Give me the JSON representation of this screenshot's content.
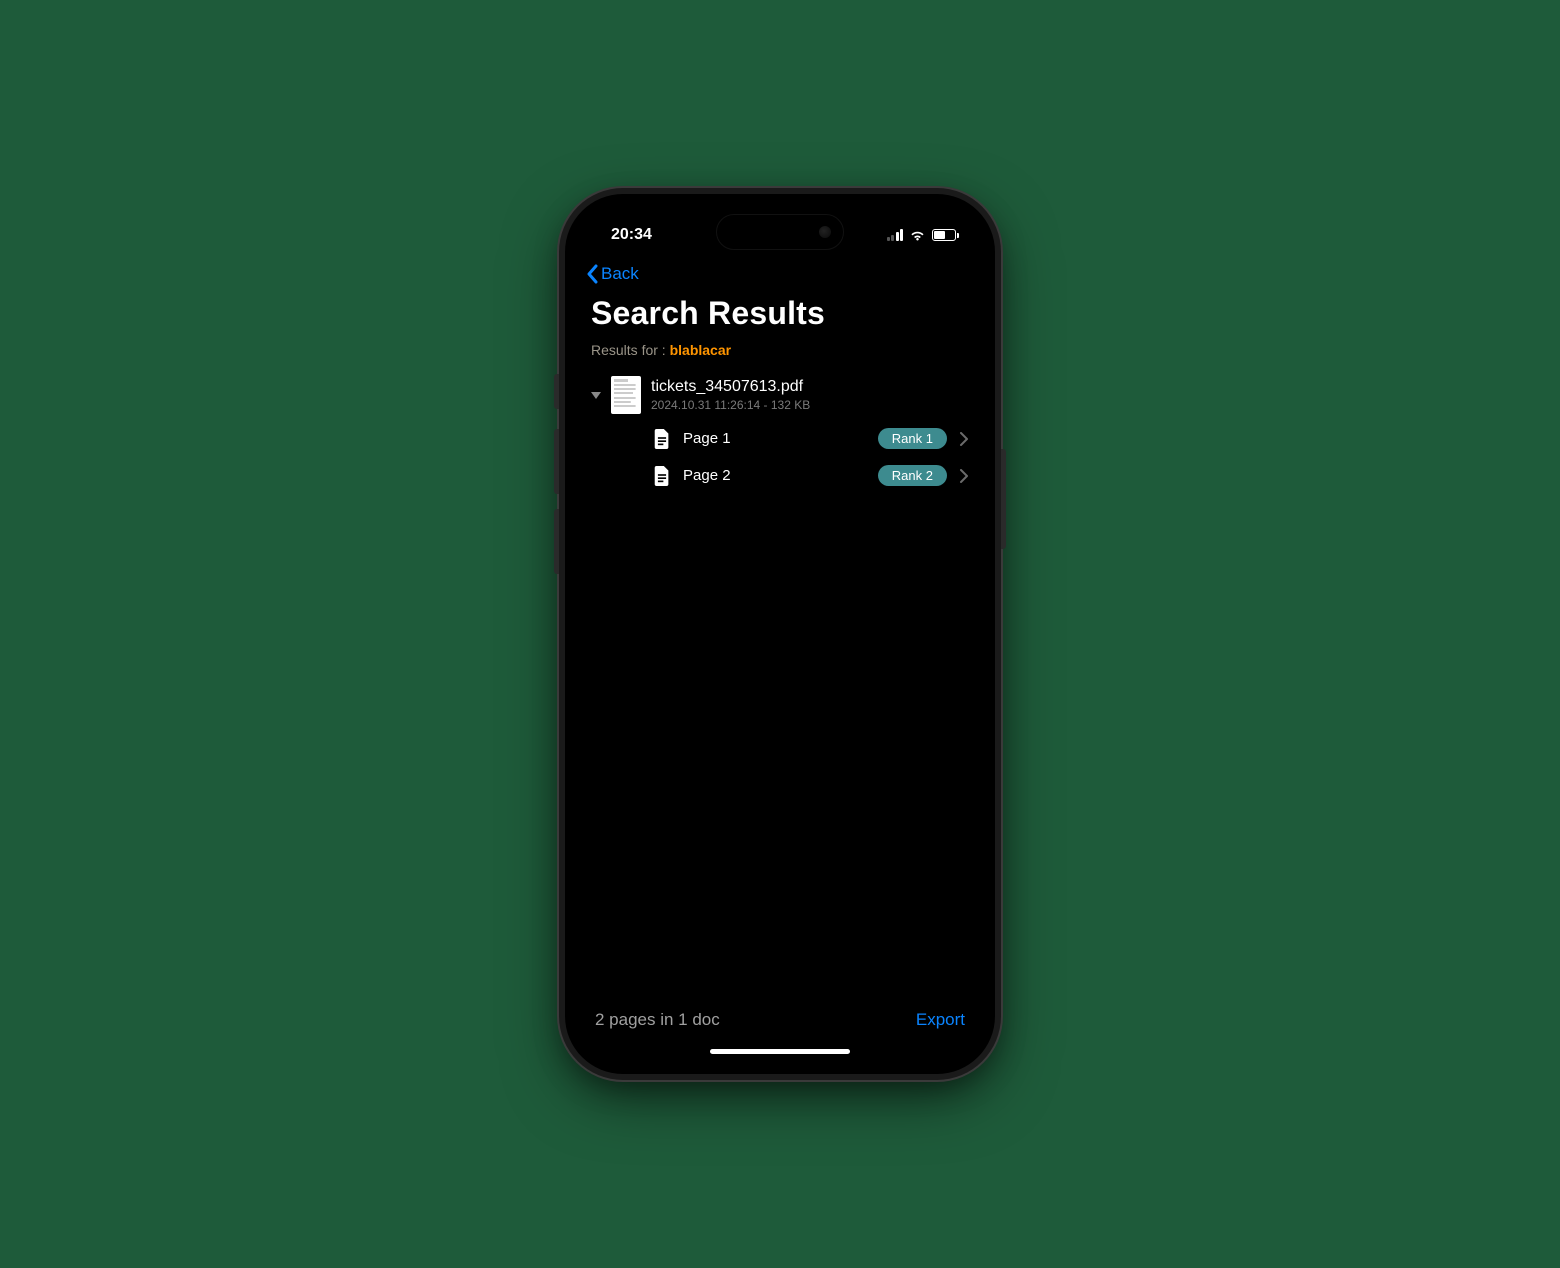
{
  "status": {
    "time": "20:34"
  },
  "nav": {
    "back_label": "Back"
  },
  "header": {
    "title": "Search Results",
    "results_prefix": "Results for : ",
    "query": "blablacar"
  },
  "document": {
    "filename": "tickets_34507613.pdf",
    "subtitle": "2024.10.31 11:26:14 - 132 KB",
    "pages": [
      {
        "label": "Page 1",
        "rank": "Rank 1"
      },
      {
        "label": "Page 2",
        "rank": "Rank 2"
      }
    ]
  },
  "footer": {
    "summary": "2 pages in 1 doc",
    "export_label": "Export"
  }
}
